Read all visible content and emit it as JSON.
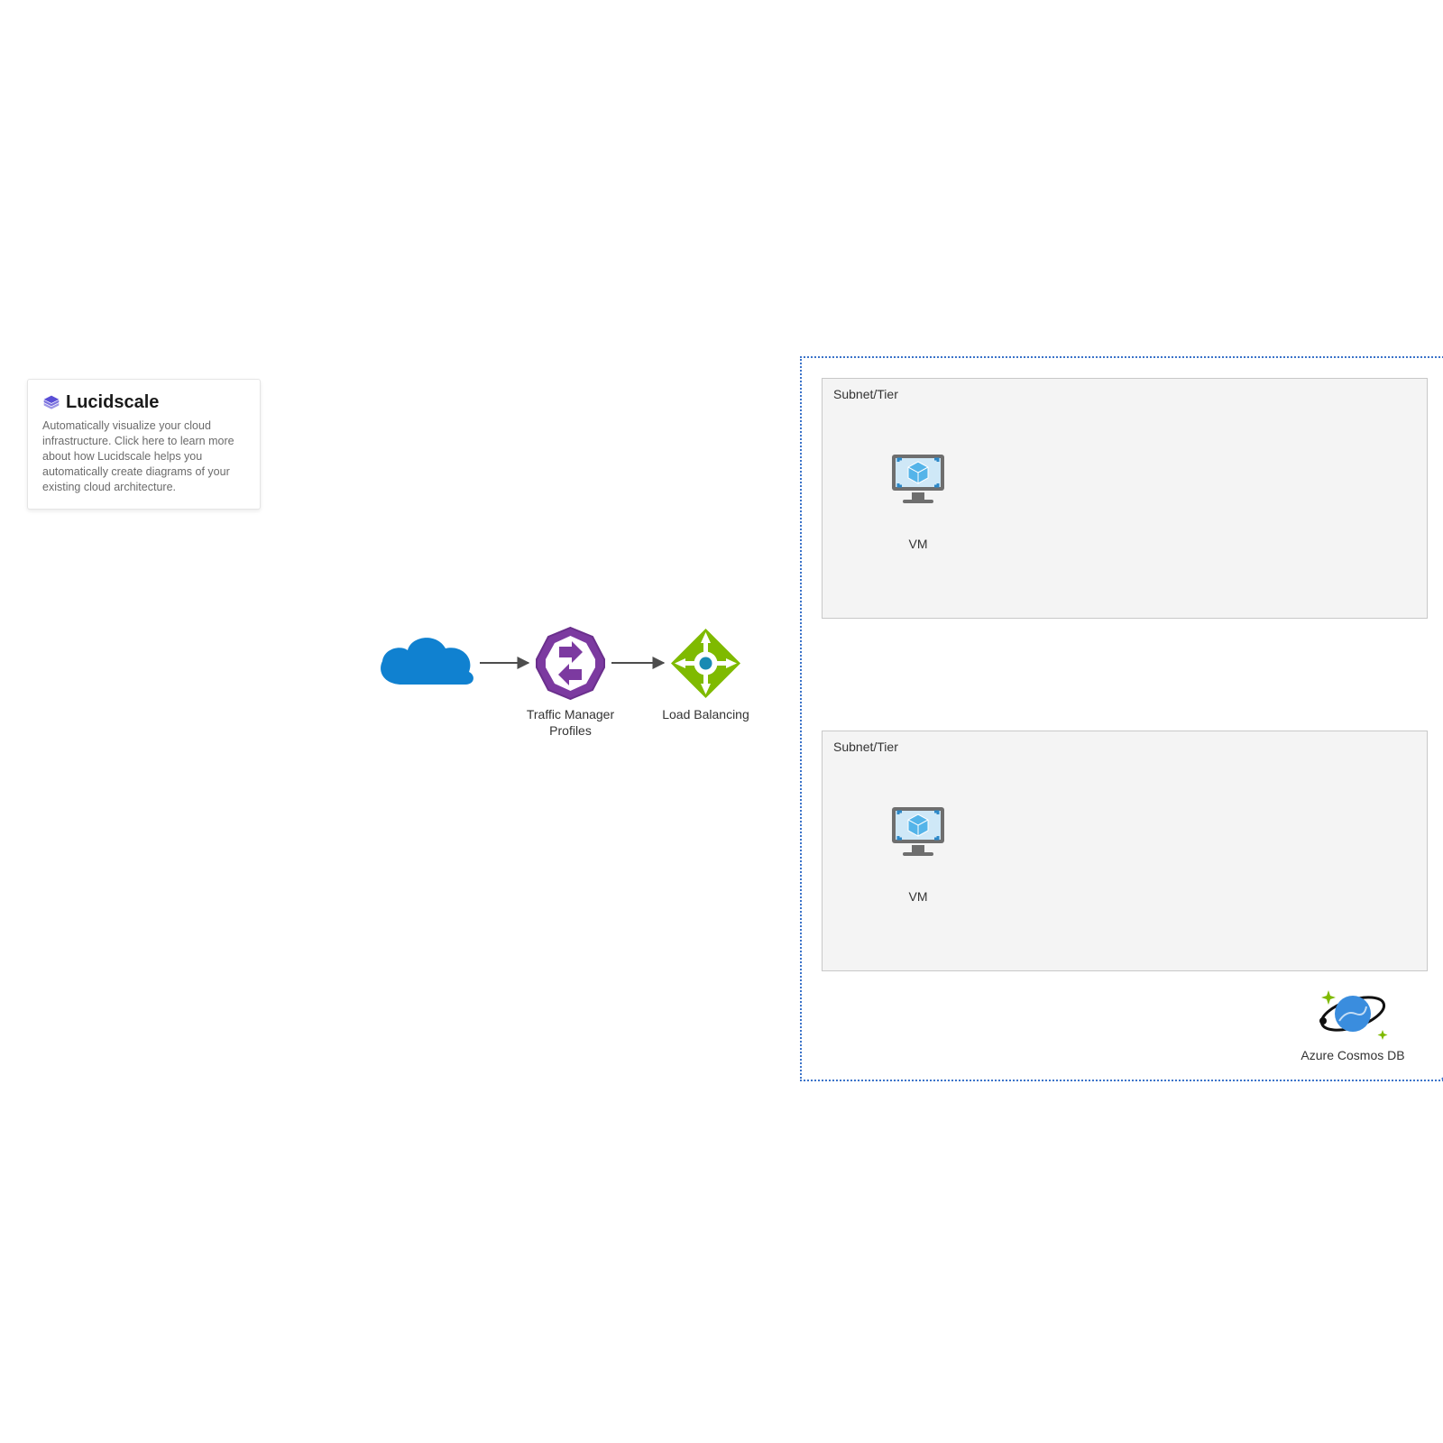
{
  "info_card": {
    "brand": "Lucidscale",
    "description": "Automatically visualize your cloud infrastructure. Click here to learn more about how Lucidscale helps you automatically create diagrams of your existing cloud architecture."
  },
  "nodes": {
    "traffic_manager_label": "Traffic Manager\nProfiles",
    "load_balancing_label": "Load Balancing",
    "vm1_label": "VM",
    "vm2_label": "VM",
    "cosmos_label": "Azure Cosmos DB"
  },
  "containers": {
    "subnet1_title": "Subnet/Tier",
    "subnet2_title": "Subnet/Tier"
  },
  "colors": {
    "azure_blue": "#0d99ff",
    "vnet_border": "#3b73c9",
    "purple": "#7c3aa0",
    "green": "#7fba00",
    "monitor_gray": "#6e6e6e",
    "vm_cube": "#54b4e9",
    "cosmos_blue": "#3a8dde",
    "cosmos_ring": "#111"
  }
}
